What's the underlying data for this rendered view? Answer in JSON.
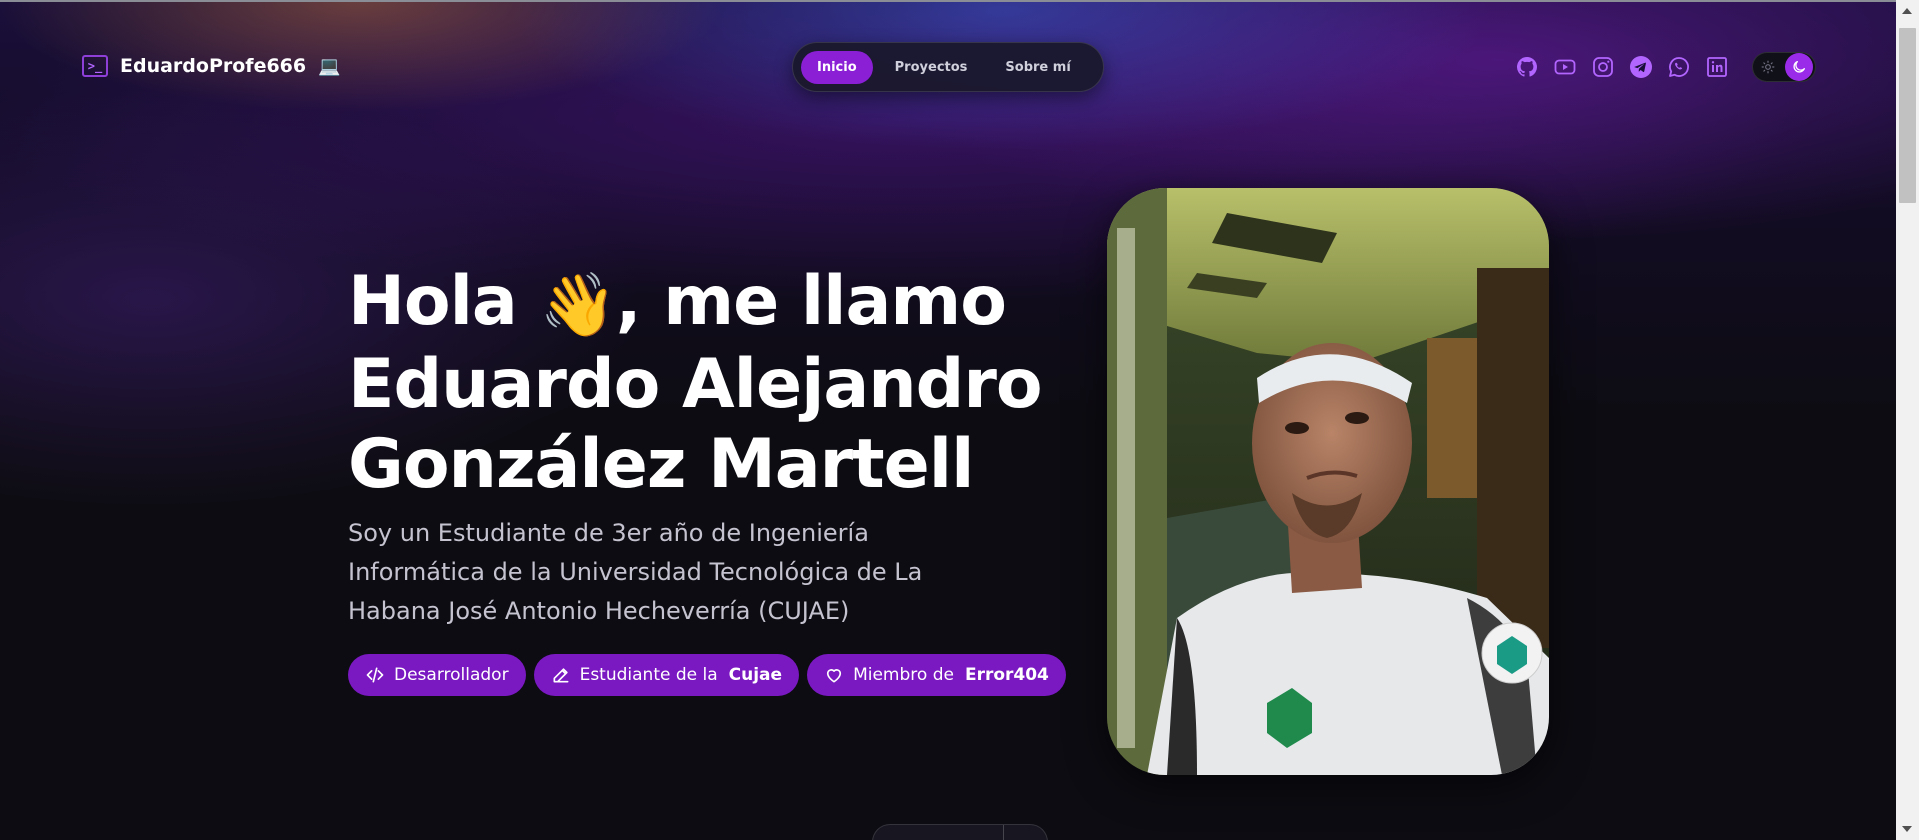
{
  "brand": {
    "name": "EduardoProfe666",
    "emoji": "💻",
    "icon_glyph": ">_"
  },
  "nav": {
    "items": [
      {
        "label": "Inicio",
        "active": true
      },
      {
        "label": "Proyectos",
        "active": false
      },
      {
        "label": "Sobre mí",
        "active": false
      }
    ]
  },
  "socials": [
    "github-icon",
    "youtube-icon",
    "instagram-icon",
    "telegram-icon",
    "whatsapp-icon",
    "linkedin-icon"
  ],
  "theme_toggle": {
    "mode": "dark"
  },
  "hero": {
    "title_line1_pre": "Hola",
    "title_emoji": "👋",
    "title_line1_post": ", me llamo",
    "title_line2": "Eduardo Alejandro",
    "title_line3": "González Martell",
    "subtitle": "Soy un Estudiante de 3er año de Ingeniería Informática de la Universidad Tecnológica de La Habana José Antonio Hecheverría (CUJAE)",
    "badges": [
      {
        "icon": "code-icon",
        "text": "Desarrollador",
        "bold": ""
      },
      {
        "icon": "pencil-icon",
        "text": "Estudiante de la",
        "bold": "Cujae"
      },
      {
        "icon": "heart-icon",
        "text": "Miembro de",
        "bold": "Error404"
      }
    ]
  },
  "colors": {
    "accent": "#8a1fd6",
    "badge_bg": "#7a18c2",
    "background": "#0d0c12"
  }
}
